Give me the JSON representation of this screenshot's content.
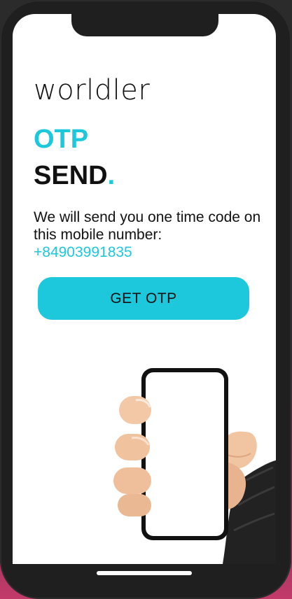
{
  "app": {
    "logo_text": "worldler"
  },
  "heading": {
    "line1": "OTP",
    "line2": "SEND",
    "line2_dot": "."
  },
  "message": {
    "text": "We will send you one time code on this mobile number:",
    "phone_number": "+84903991835"
  },
  "action": {
    "button_label": "GET OTP"
  },
  "colors": {
    "accent": "#1ec8dc",
    "text": "#111111",
    "background": "#ffffff",
    "frame": "#1f1f1f"
  },
  "illustration": {
    "icon": "hand-holding-phone-icon"
  }
}
